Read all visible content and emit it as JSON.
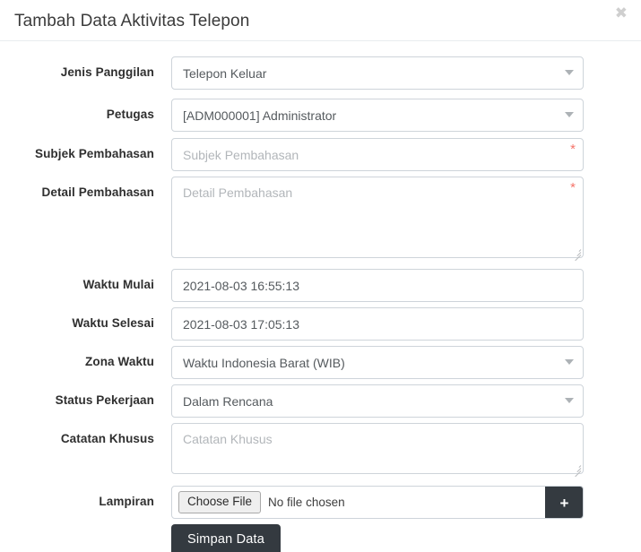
{
  "modal": {
    "title": "Tambah Data Aktivitas Telepon",
    "close_icon": "close-icon",
    "close_glyph": "✖"
  },
  "form": {
    "fields": [
      {
        "label": "Jenis Panggilan",
        "type": "select",
        "value": "Telepon Keluar",
        "required": false
      },
      {
        "label": "Petugas",
        "type": "select",
        "value": "[ADM000001] Administrator",
        "required": false
      },
      {
        "label": "Subjek Pembahasan",
        "type": "text",
        "value": "",
        "placeholder": "Subjek Pembahasan",
        "required": true,
        "required_marker": "*"
      },
      {
        "label": "Detail Pembahasan",
        "type": "textarea",
        "value": "",
        "placeholder": "Detail Pembahasan",
        "required": true,
        "required_marker": "*"
      },
      {
        "label": "Waktu Mulai",
        "type": "text",
        "value": "2021-08-03 16:55:13",
        "required": false
      },
      {
        "label": "Waktu Selesai",
        "type": "text",
        "value": "2021-08-03 17:05:13",
        "required": false
      },
      {
        "label": "Zona Waktu",
        "type": "select",
        "value": "Waktu Indonesia Barat (WIB)",
        "required": false
      },
      {
        "label": "Status Pekerjaan",
        "type": "select",
        "value": "Dalam Rencana",
        "required": false
      },
      {
        "label": "Catatan Khusus",
        "type": "textarea",
        "value": "",
        "placeholder": "Catatan Khusus",
        "required": false
      },
      {
        "label": "Lampiran",
        "type": "file",
        "choose_label": "Choose File",
        "no_file_text": "No file chosen",
        "add_glyph": "+",
        "required": false
      }
    ],
    "submit_label": "Simpan Data"
  },
  "colors": {
    "button_dark": "#343a40",
    "required_asterisk": "#f5746a",
    "border": "#ced4da",
    "placeholder": "#b2b6ba"
  }
}
